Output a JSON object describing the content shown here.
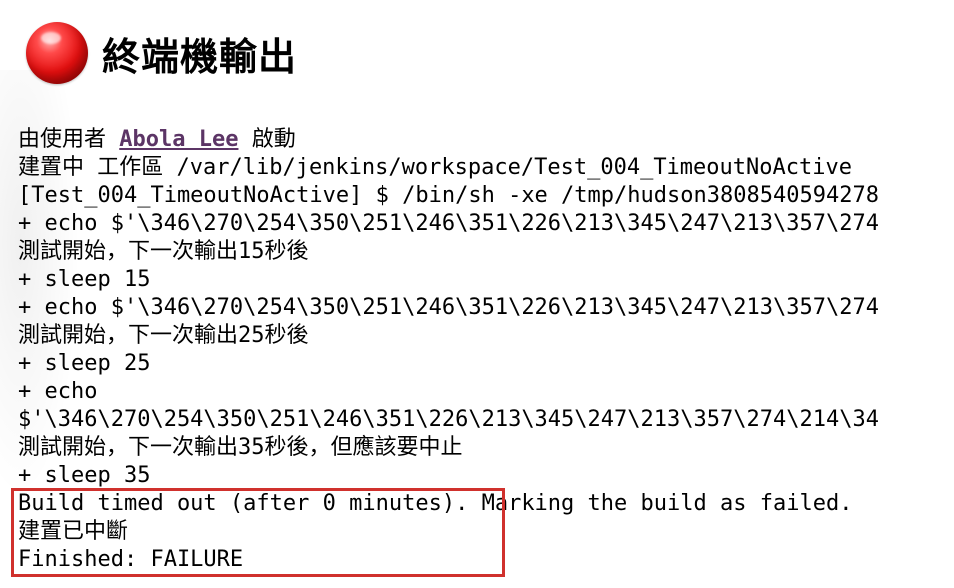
{
  "header": {
    "title": "終端機輸出",
    "status_color": "#e10f0f",
    "status_icon": "red-ball-icon"
  },
  "console": {
    "started_by": {
      "prefix": "由使用者 ",
      "user": "Abola Lee",
      "suffix": " 啟動"
    },
    "lines": [
      "建置中 工作區 /var/lib/jenkins/workspace/Test_004_TimeoutNoActive",
      "[Test_004_TimeoutNoActive] $ /bin/sh -xe /tmp/hudson3808540594278",
      "+ echo $'\\346\\270\\254\\350\\251\\246\\351\\226\\213\\345\\247\\213\\357\\274",
      "測試開始，下一次輸出15秒後",
      "+ sleep 15",
      "+ echo $'\\346\\270\\254\\350\\251\\246\\351\\226\\213\\345\\247\\213\\357\\274",
      "測試開始，下一次輸出25秒後",
      "+ sleep 25",
      "+ echo",
      "$'\\346\\270\\254\\350\\251\\246\\351\\226\\213\\345\\247\\213\\357\\274\\214\\34",
      "測試開始，下一次輸出35秒後，但應該要中止",
      "+ sleep 35",
      "Build timed out (after 0 minutes). Marking the build as failed.",
      "建置已中斷",
      "Finished: FAILURE"
    ],
    "link_color": "#5c3566",
    "highlight_color": "#d0312d"
  }
}
